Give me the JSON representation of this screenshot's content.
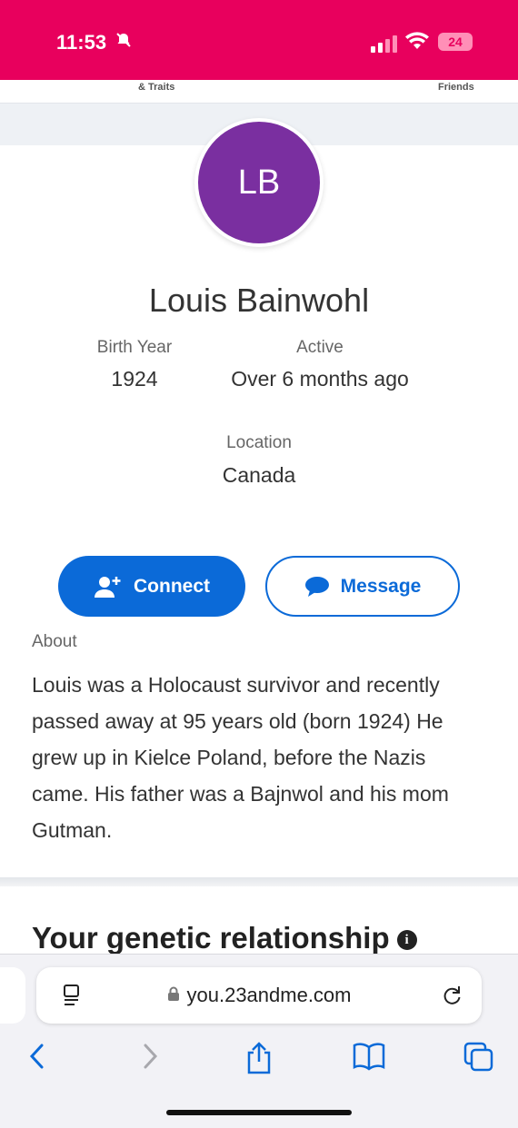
{
  "status_bar": {
    "time": "11:53",
    "battery": "24"
  },
  "nav_tabs": [
    "& Traits",
    "Friends"
  ],
  "profile": {
    "initials": "LB",
    "name": "Louis Bainwohl",
    "birth_year_label": "Birth Year",
    "birth_year": "1924",
    "active_label": "Active",
    "active": "Over 6 months ago",
    "location_label": "Location",
    "location": "Canada"
  },
  "actions": {
    "connect_label": "Connect",
    "message_label": "Message"
  },
  "about": {
    "label": "About",
    "text": "Louis was a Holocaust survivor and recently passed away at 95 years old (born 1924) He grew up in Kielce Poland, before the Nazis came. His father was a Bajnwol and his mom Gutman."
  },
  "genetic": {
    "title": "Your genetic relationship"
  },
  "browser": {
    "url": "you.23andme.com"
  },
  "colors": {
    "brand_pink": "#e8005d",
    "avatar_purple": "#7a2fa0",
    "action_blue": "#0b6ad8"
  }
}
